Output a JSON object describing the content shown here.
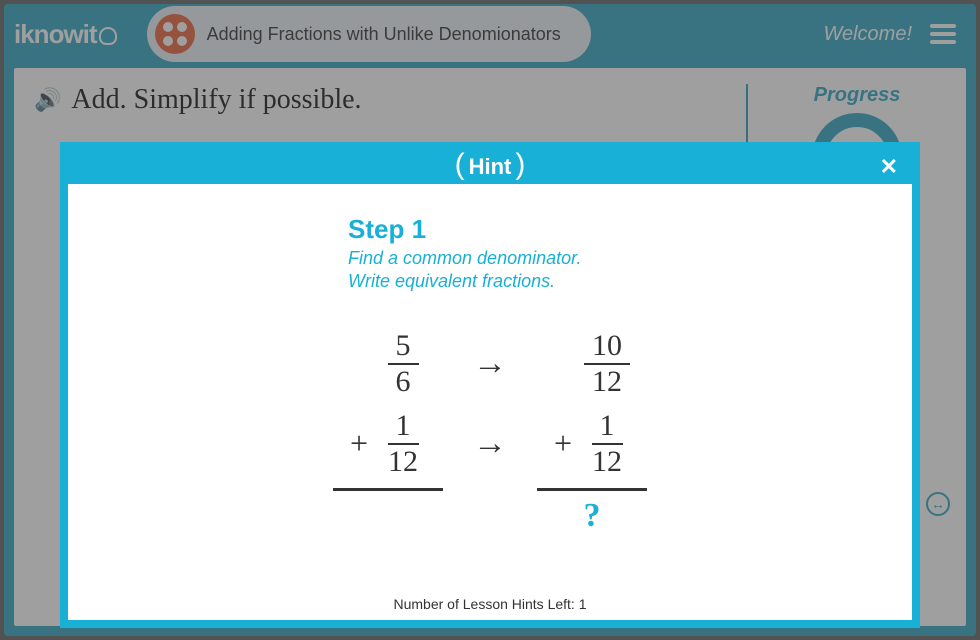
{
  "header": {
    "logo_text": "iknowit",
    "lesson_title": "Adding Fractions with Unlike Denomionators",
    "welcome": "Welcome!"
  },
  "question": {
    "prompt": "Add. Simplify if possible."
  },
  "sidebar": {
    "progress_label": "Progress"
  },
  "hint": {
    "title": "Hint",
    "step_label": "Step 1",
    "instruction_line1": "Find a common denominator.",
    "instruction_line2": "Write equivalent fractions.",
    "left": {
      "top_num": "5",
      "top_den": "6",
      "bot_num": "1",
      "bot_den": "12"
    },
    "right": {
      "top_num": "10",
      "top_den": "12",
      "bot_num": "1",
      "bot_den": "12"
    },
    "result_placeholder": "?",
    "hints_left_label": "Number of Lesson Hints Left: 1"
  }
}
